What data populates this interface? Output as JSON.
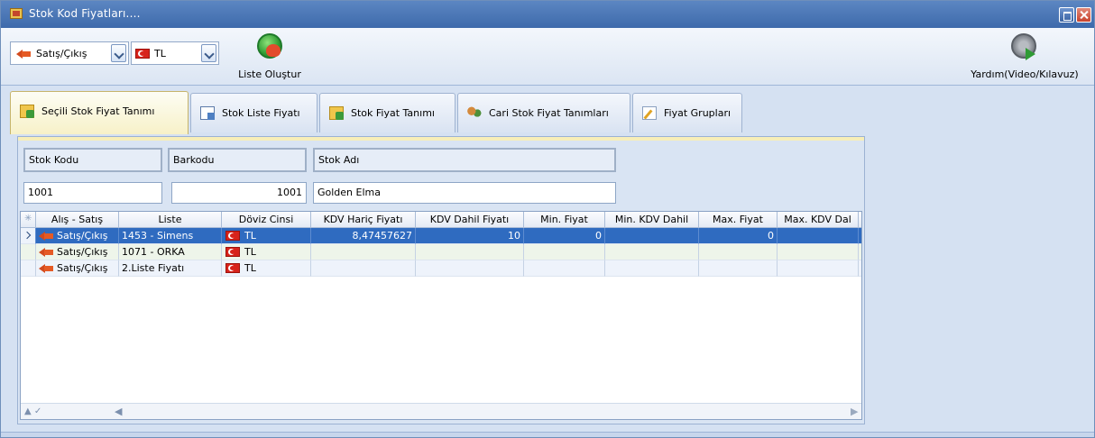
{
  "window": {
    "title": "Stok Kod Fiyatları...."
  },
  "toolbar": {
    "direction": "Satış/Çıkış",
    "currency": "TL",
    "create_list": "Liste Oluştur",
    "help": "Yardım(Video/Kılavuz)"
  },
  "tabs": [
    {
      "label": "Seçili Stok Fiyat Tanımı",
      "icon": "table-icon",
      "active": true
    },
    {
      "label": "Stok Liste Fiyatı",
      "icon": "doc-icon"
    },
    {
      "label": "Stok Fiyat Tanımı",
      "icon": "table-icon"
    },
    {
      "label": "Cari Stok Fiyat Tanımları",
      "icon": "people-icon"
    },
    {
      "label": "Fiyat Grupları",
      "icon": "edit-icon"
    }
  ],
  "fields": {
    "code_label": "Stok Kodu",
    "barcode_label": "Barkodu",
    "name_label": "Stok Adı",
    "code_value": "1001",
    "barcode_value": "1001",
    "name_value": "Golden Elma"
  },
  "grid": {
    "columns": [
      "Alış - Satış",
      "Liste",
      "Döviz Cinsi",
      "KDV Hariç Fiyatı",
      "KDV Dahil Fiyatı",
      "Min. Fiyat",
      "Min. KDV Dahil",
      "Max. Fiyat",
      "Max. KDV Dal"
    ],
    "rows": [
      {
        "direction": "Satış/Çıkış",
        "list": "1453 - Simens",
        "currency": "TL",
        "price_excl": "8,47457627",
        "price_incl": "10",
        "min_price": "0",
        "min_incl": "",
        "max_price": "0",
        "max_incl": ""
      },
      {
        "direction": "Satış/Çıkış",
        "list": "1071 - ORKA",
        "currency": "TL",
        "price_excl": "",
        "price_incl": "",
        "min_price": "",
        "min_incl": "",
        "max_price": "",
        "max_incl": ""
      },
      {
        "direction": "Satış/Çıkış",
        "list": "2.Liste Fiyatı",
        "currency": "TL",
        "price_excl": "",
        "price_incl": "",
        "min_price": "",
        "min_incl": "",
        "max_price": "",
        "max_incl": ""
      }
    ]
  },
  "colors": {
    "selected_row": "#2f6bc0",
    "active_tab": "#f7f1c8",
    "titlebar": "#4a76b6"
  }
}
